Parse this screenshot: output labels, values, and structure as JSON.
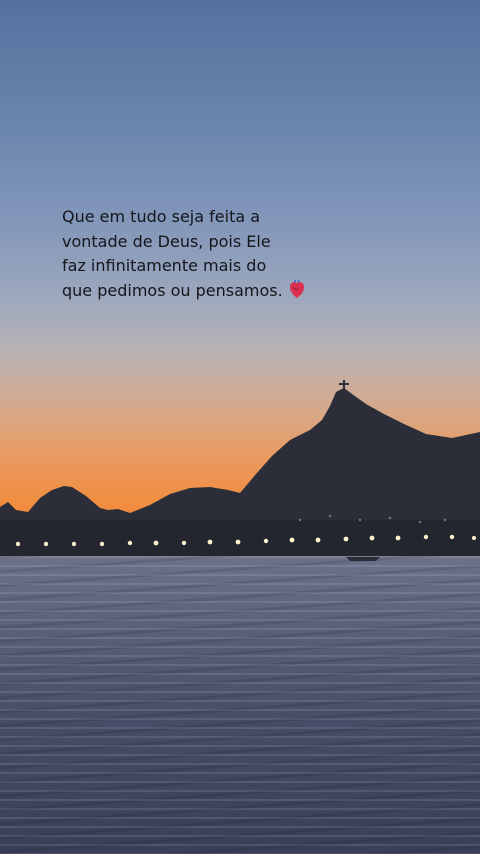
{
  "caption": {
    "lines": [
      "Que em tudo seja feita a",
      "vontade de Deus, pois Ele",
      "faz infinitamente mais do",
      "que pedimos ou pensamos."
    ],
    "emoji": "anatomical-heart-icon"
  },
  "colors": {
    "sky_top": "#54719e",
    "sunset": "#f08d40",
    "mountain": "#2c2f3a",
    "sea": "#4a5068",
    "caption_text": "#15161c"
  }
}
